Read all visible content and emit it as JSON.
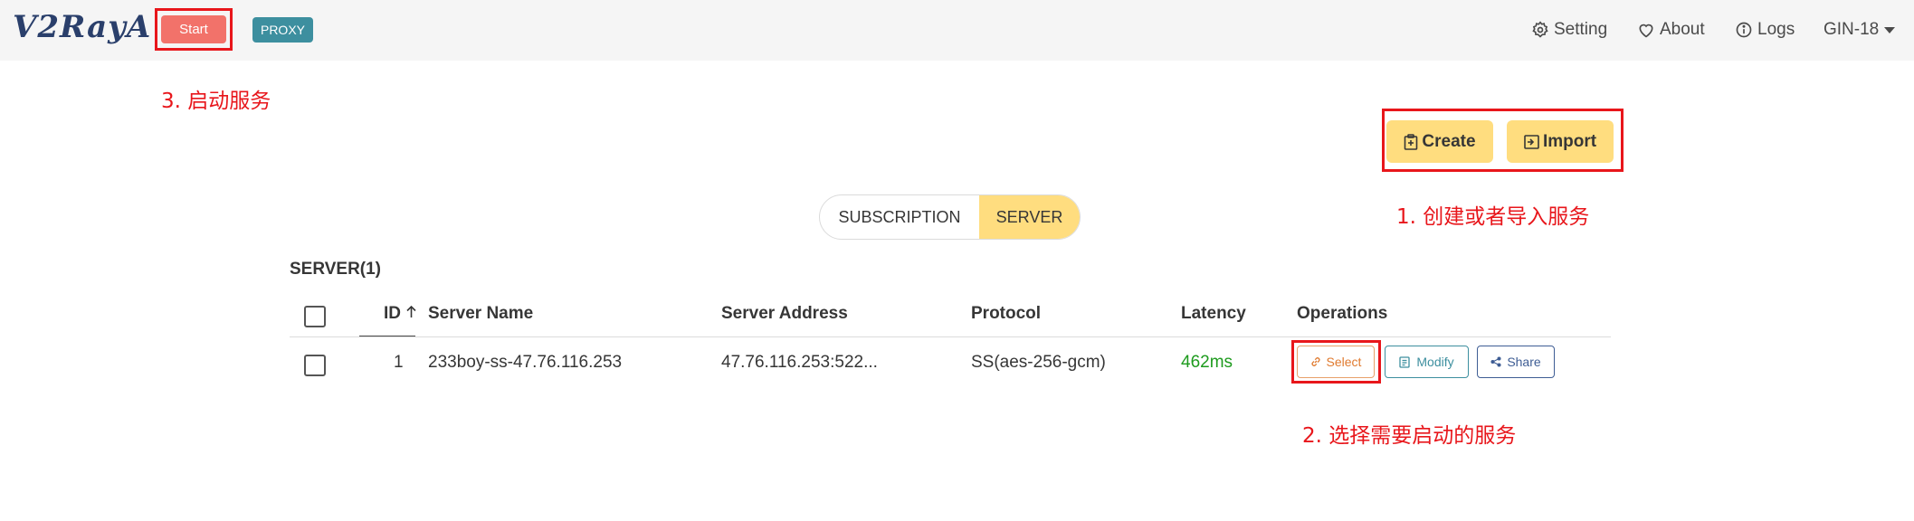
{
  "navbar": {
    "logo": "V2RayA",
    "start_label": "Start",
    "proxy_label": "PROXY",
    "setting_label": "Setting",
    "about_label": "About",
    "logs_label": "Logs",
    "user_label": "GIN-18"
  },
  "annotations": {
    "step3": "3. 启动服务",
    "step1": "1.  创建或者导入服务",
    "step2": "2. 选择需要启动的服务"
  },
  "actions": {
    "create_label": "Create",
    "import_label": "Import"
  },
  "tabs": {
    "subscription": "SUBSCRIPTION",
    "server": "SERVER"
  },
  "table": {
    "title": "SERVER(1)",
    "headers": {
      "id": "ID",
      "name": "Server Name",
      "address": "Server Address",
      "protocol": "Protocol",
      "latency": "Latency",
      "operations": "Operations"
    },
    "rows": [
      {
        "id": "1",
        "name": "233boy-ss-47.76.116.253",
        "address": "47.76.116.253:522...",
        "protocol": "SS(aes-256-gcm)",
        "latency": "462ms",
        "select_label": "Select",
        "modify_label": "Modify",
        "share_label": "Share"
      }
    ]
  },
  "colors": {
    "accent_yellow": "#ffdd7f",
    "start_red": "#f2726a",
    "proxy_teal": "#3d8f9f",
    "latency_green": "#1e9b1e",
    "annotation_red": "#e8161b"
  }
}
